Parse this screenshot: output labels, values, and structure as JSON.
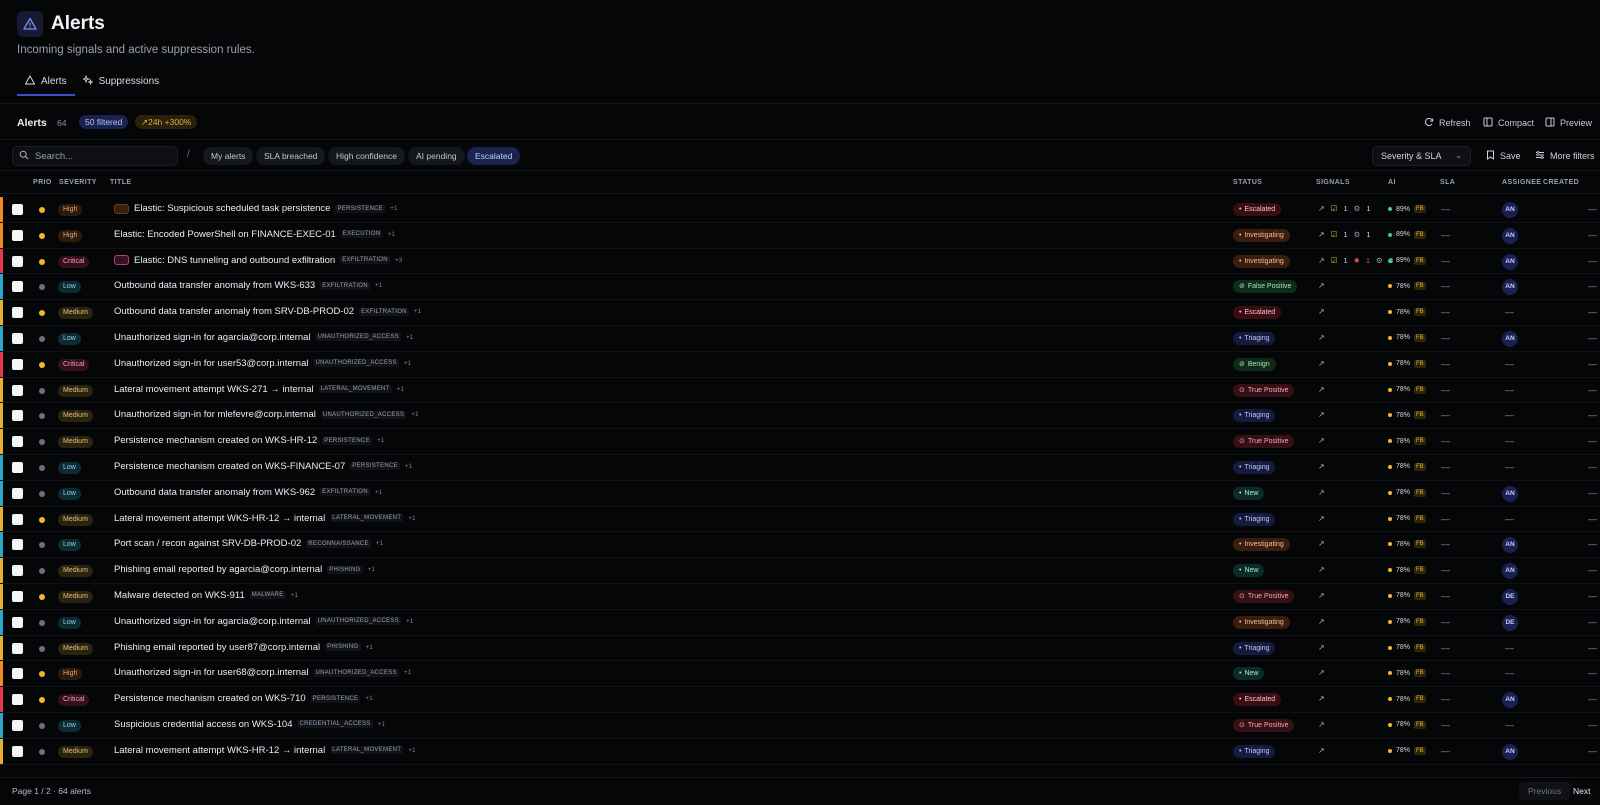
{
  "header": {
    "title": "Alerts",
    "subtitle": "Incoming signals and active suppression rules.",
    "tabs": [
      {
        "label": "Alerts",
        "active": true
      },
      {
        "label": "Suppressions",
        "active": false
      }
    ]
  },
  "toolbar": {
    "title": "Alerts",
    "count": "64",
    "filtered": "50 filtered",
    "trend": "↗24h +300%",
    "actions": {
      "refresh": "Refresh",
      "compact": "Compact",
      "preview": "Preview"
    }
  },
  "filters": {
    "search_placeholder": "Search...",
    "slash": "/",
    "chips": [
      "My alerts",
      "SLA breached",
      "High confidence",
      "AI pending",
      "Escalated"
    ],
    "active_chip": "Escalated",
    "sort": "Severity & SLA",
    "save": "Save",
    "more": "More filters"
  },
  "columns": {
    "prio": "PRIO",
    "severity": "SEVERITY",
    "title": "TITLE",
    "status": "STATUS",
    "signals": "SIGNALS",
    "ai": "AI",
    "sla": "SLA",
    "assignee": "ASSIGNEE",
    "created": "CREATED"
  },
  "colors": {
    "prio_high": "#f5b531",
    "prio_low": "#6b707c",
    "edge_critical": "#e23a4c",
    "edge_high": "#f08a24",
    "edge_medium": "#e8b12c",
    "edge_low": "#2aa6c8"
  },
  "rows": [
    {
      "severity": "High",
      "prio": "high",
      "title": "Elastic: Suspicious scheduled task persistence",
      "tactic": "PERSISTENCE",
      "plus": "+1",
      "status": "Escalated",
      "icon": "orange",
      "signals": {
        "a": "1",
        "b": "1"
      },
      "ai": "89%",
      "ai_color": "#3ecf8e",
      "sla": "—",
      "assignee": "AN",
      "created": "—"
    },
    {
      "severity": "High",
      "prio": "high",
      "title": "Elastic: Encoded PowerShell on FINANCE-EXEC-01",
      "tactic": "EXECUTION",
      "plus": "+1",
      "status": "Investigating",
      "icon": "",
      "signals": {
        "a": "1",
        "b": "1"
      },
      "ai": "89%",
      "ai_color": "#3ecf8e",
      "sla": "—",
      "assignee": "AN",
      "created": "—"
    },
    {
      "severity": "Critical",
      "prio": "high",
      "title": "Elastic: DNS tunneling and outbound exfiltration",
      "tactic": "EXFILTRATION",
      "plus": "+3",
      "status": "Investigating",
      "icon": "pink",
      "signals": {
        "a": "1",
        "c": "1",
        "b": "3"
      },
      "ai": "89%",
      "ai_color": "#3ecf8e",
      "sla": "—",
      "assignee": "AN",
      "created": "—"
    },
    {
      "severity": "Low",
      "prio": "low",
      "title": "Outbound data transfer anomaly from WKS-633",
      "tactic": "EXFILTRATION",
      "plus": "+1",
      "status": "False Positive",
      "icon": "",
      "ai": "78%",
      "ai_color": "#f5b531",
      "sla": "—",
      "assignee": "AN",
      "created": "—"
    },
    {
      "severity": "Medium",
      "prio": "high",
      "title": "Outbound data transfer anomaly from SRV-DB-PROD-02",
      "tactic": "EXFILTRATION",
      "plus": "+1",
      "status": "Escalated",
      "icon": "",
      "ai": "78%",
      "ai_color": "#f5b531",
      "sla": "—",
      "assignee": "",
      "created": "—"
    },
    {
      "severity": "Low",
      "prio": "low",
      "title": "Unauthorized sign-in for agarcia@corp.internal",
      "tactic": "UNAUTHORIZED_ACCESS",
      "plus": "+1",
      "status": "Triaging",
      "icon": "",
      "ai": "78%",
      "ai_color": "#f5b531",
      "sla": "—",
      "assignee": "AN",
      "created": "—"
    },
    {
      "severity": "Critical",
      "prio": "high",
      "title": "Unauthorized sign-in for user53@corp.internal",
      "tactic": "UNAUTHORIZED_ACCESS",
      "plus": "+1",
      "status": "Benign",
      "icon": "",
      "ai": "78%",
      "ai_color": "#f5b531",
      "sla": "—",
      "assignee": "",
      "created": "—"
    },
    {
      "severity": "Medium",
      "prio": "low",
      "title": "Lateral movement attempt WKS-271 → internal",
      "tactic": "LATERAL_MOVEMENT",
      "plus": "+1",
      "status": "True Positive",
      "icon": "",
      "ai": "78%",
      "ai_color": "#f5b531",
      "sla": "—",
      "assignee": "",
      "created": "—"
    },
    {
      "severity": "Medium",
      "prio": "low",
      "title": "Unauthorized sign-in for mlefevre@corp.internal",
      "tactic": "UNAUTHORIZED_ACCESS",
      "plus": "+1",
      "status": "Triaging",
      "icon": "",
      "ai": "78%",
      "ai_color": "#f5b531",
      "sla": "—",
      "assignee": "",
      "created": "—"
    },
    {
      "severity": "Medium",
      "prio": "low",
      "title": "Persistence mechanism created on WKS-HR-12",
      "tactic": "PERSISTENCE",
      "plus": "+1",
      "status": "True Positive",
      "icon": "",
      "ai": "78%",
      "ai_color": "#f5b531",
      "sla": "—",
      "assignee": "",
      "created": "—"
    },
    {
      "severity": "Low",
      "prio": "low",
      "title": "Persistence mechanism created on WKS-FINANCE-07",
      "tactic": "PERSISTENCE",
      "plus": "+1",
      "status": "Triaging",
      "icon": "",
      "ai": "78%",
      "ai_color": "#f5b531",
      "sla": "—",
      "assignee": "",
      "created": "—"
    },
    {
      "severity": "Low",
      "prio": "low",
      "title": "Outbound data transfer anomaly from WKS-962",
      "tactic": "EXFILTRATION",
      "plus": "+1",
      "status": "New",
      "icon": "",
      "ai": "78%",
      "ai_color": "#f5b531",
      "sla": "—",
      "assignee": "AN",
      "created": "—"
    },
    {
      "severity": "Medium",
      "prio": "high",
      "title": "Lateral movement attempt WKS-HR-12 → internal",
      "tactic": "LATERAL_MOVEMENT",
      "plus": "+1",
      "status": "Triaging",
      "icon": "",
      "ai": "78%",
      "ai_color": "#f5b531",
      "sla": "—",
      "assignee": "",
      "created": "—"
    },
    {
      "severity": "Low",
      "prio": "low",
      "title": "Port scan / recon against SRV-DB-PROD-02",
      "tactic": "RECONNAISSANCE",
      "plus": "+1",
      "status": "Investigating",
      "icon": "",
      "ai": "78%",
      "ai_color": "#f5b531",
      "sla": "—",
      "assignee": "AN",
      "created": "—"
    },
    {
      "severity": "Medium",
      "prio": "low",
      "title": "Phishing email reported by agarcia@corp.internal",
      "tactic": "PHISHING",
      "plus": "+1",
      "status": "New",
      "icon": "",
      "ai": "78%",
      "ai_color": "#f5b531",
      "sla": "—",
      "assignee": "AN",
      "created": "—"
    },
    {
      "severity": "Medium",
      "prio": "high",
      "title": "Malware detected on WKS-911",
      "tactic": "MALWARE",
      "plus": "+1",
      "status": "True Positive",
      "icon": "",
      "ai": "78%",
      "ai_color": "#f5b531",
      "sla": "—",
      "assignee": "DE",
      "created": "—"
    },
    {
      "severity": "Low",
      "prio": "low",
      "title": "Unauthorized sign-in for agarcia@corp.internal",
      "tactic": "UNAUTHORIZED_ACCESS",
      "plus": "+1",
      "status": "Investigating",
      "icon": "",
      "ai": "78%",
      "ai_color": "#f5b531",
      "sla": "—",
      "assignee": "DE",
      "created": "—"
    },
    {
      "severity": "Medium",
      "prio": "low",
      "title": "Phishing email reported by user87@corp.internal",
      "tactic": "PHISHING",
      "plus": "+1",
      "status": "Triaging",
      "icon": "",
      "ai": "78%",
      "ai_color": "#f5b531",
      "sla": "—",
      "assignee": "",
      "created": "—"
    },
    {
      "severity": "High",
      "prio": "high",
      "title": "Unauthorized sign-in for user68@corp.internal",
      "tactic": "UNAUTHORIZED_ACCESS",
      "plus": "+1",
      "status": "New",
      "icon": "",
      "ai": "78%",
      "ai_color": "#f5b531",
      "sla": "—",
      "assignee": "",
      "created": "—"
    },
    {
      "severity": "Critical",
      "prio": "high",
      "title": "Persistence mechanism created on WKS-710",
      "tactic": "PERSISTENCE",
      "plus": "+1",
      "status": "Escalated",
      "icon": "",
      "ai": "78%",
      "ai_color": "#f5b531",
      "sla": "—",
      "assignee": "AN",
      "created": "—"
    },
    {
      "severity": "Low",
      "prio": "low",
      "title": "Suspicious credential access on WKS-104",
      "tactic": "CREDENTIAL_ACCESS",
      "plus": "+1",
      "status": "True Positive",
      "icon": "",
      "ai": "78%",
      "ai_color": "#f5b531",
      "sla": "—",
      "assignee": "",
      "created": "—"
    },
    {
      "severity": "Medium",
      "prio": "low",
      "title": "Lateral movement attempt WKS-HR-12 → internal",
      "tactic": "LATERAL_MOVEMENT",
      "plus": "+1",
      "status": "Triaging",
      "icon": "",
      "ai": "78%",
      "ai_color": "#f5b531",
      "sla": "—",
      "assignee": "AN",
      "created": "—"
    }
  ],
  "footer": {
    "page_info": "Page 1 / 2 · 64 alerts",
    "previous": "Previous",
    "next": "Next"
  }
}
